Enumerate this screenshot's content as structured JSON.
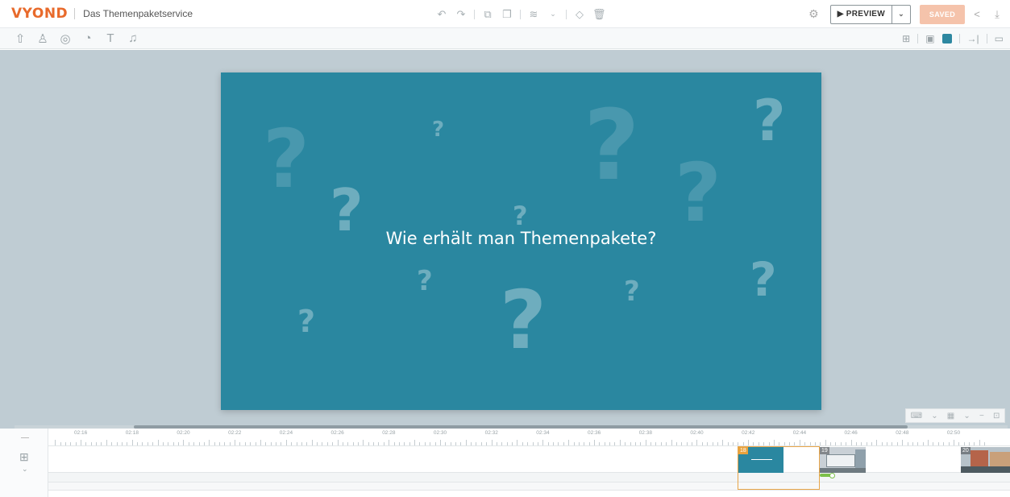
{
  "header": {
    "logo": "VYOND",
    "project_title": "Das Themenpaketservice",
    "preview_label": "▶ PREVIEW",
    "saved_label": "SAVED"
  },
  "scene": {
    "text": "Wie erhält man Themenpakete?",
    "background_color": "#2a87a0"
  },
  "timeline": {
    "time_labels": [
      "02:16",
      "02:18",
      "02:20",
      "02:22",
      "02:24",
      "02:26",
      "02:28",
      "02:30",
      "02:32",
      "02:34",
      "02:36",
      "02:38",
      "02:40",
      "02:42",
      "02:44",
      "02:46",
      "02:48",
      "02:50"
    ],
    "scenes": [
      {
        "number": "18"
      },
      {
        "number": "19"
      },
      {
        "number": "20"
      }
    ]
  },
  "colors": {
    "brand": "#e86a2b",
    "saved_button": "#f5c3ab",
    "selection": "#e9a64a",
    "audio_marker": "#7cc04a"
  },
  "icons": {
    "center_toolbar": [
      "undo-icon",
      "redo-icon",
      "copy-icon",
      "paste-icon",
      "layers-icon",
      "eraser-icon",
      "trash-icon"
    ],
    "asset_toolbar": [
      "upload-icon",
      "character-icon",
      "props-icon",
      "charts-icon",
      "text-icon",
      "music-icon"
    ],
    "right_toolbar": [
      "scene-layout-icon",
      "background-image-icon",
      "enter-effect-icon",
      "camera-icon"
    ]
  }
}
